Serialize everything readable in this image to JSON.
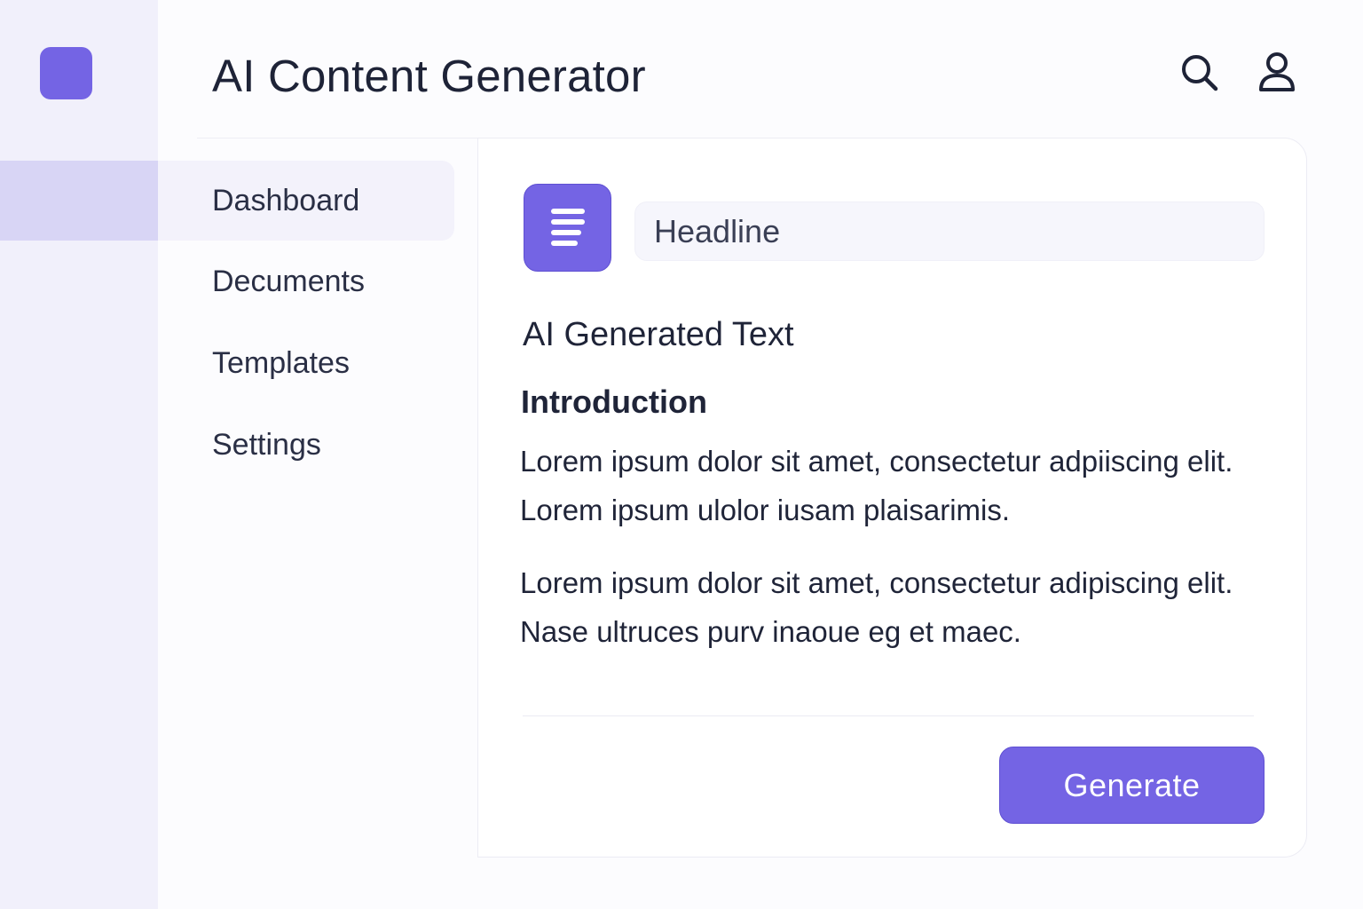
{
  "app": {
    "title": "AI Content Generator"
  },
  "header": {
    "icons": [
      "search-icon",
      "user-icon"
    ]
  },
  "nav": {
    "items": [
      {
        "label": "Dashboard",
        "active": true
      },
      {
        "label": "Decuments",
        "active": false
      },
      {
        "label": "Templates",
        "active": false
      },
      {
        "label": "Settings",
        "active": false
      }
    ]
  },
  "editor": {
    "headline_value": "Headline",
    "section_title": "AI Generated Text",
    "subtitle": "Introduction",
    "paragraphs": [
      "Lorem ipsum dolor sit amet, consectetur adpiiscing elit. Lorem ipsum ulolor iusam plaisarimis.",
      "Lorem ipsum dolor sit amet, consectetur adipiscing elit. Nase ultruces purv inaoue eg et maec."
    ],
    "generate_label": "Generate"
  },
  "colors": {
    "accent": "#7464e4",
    "rail_bg": "#f1f0fb",
    "rail_active": "#d8d5f5",
    "text": "#1f2438"
  }
}
